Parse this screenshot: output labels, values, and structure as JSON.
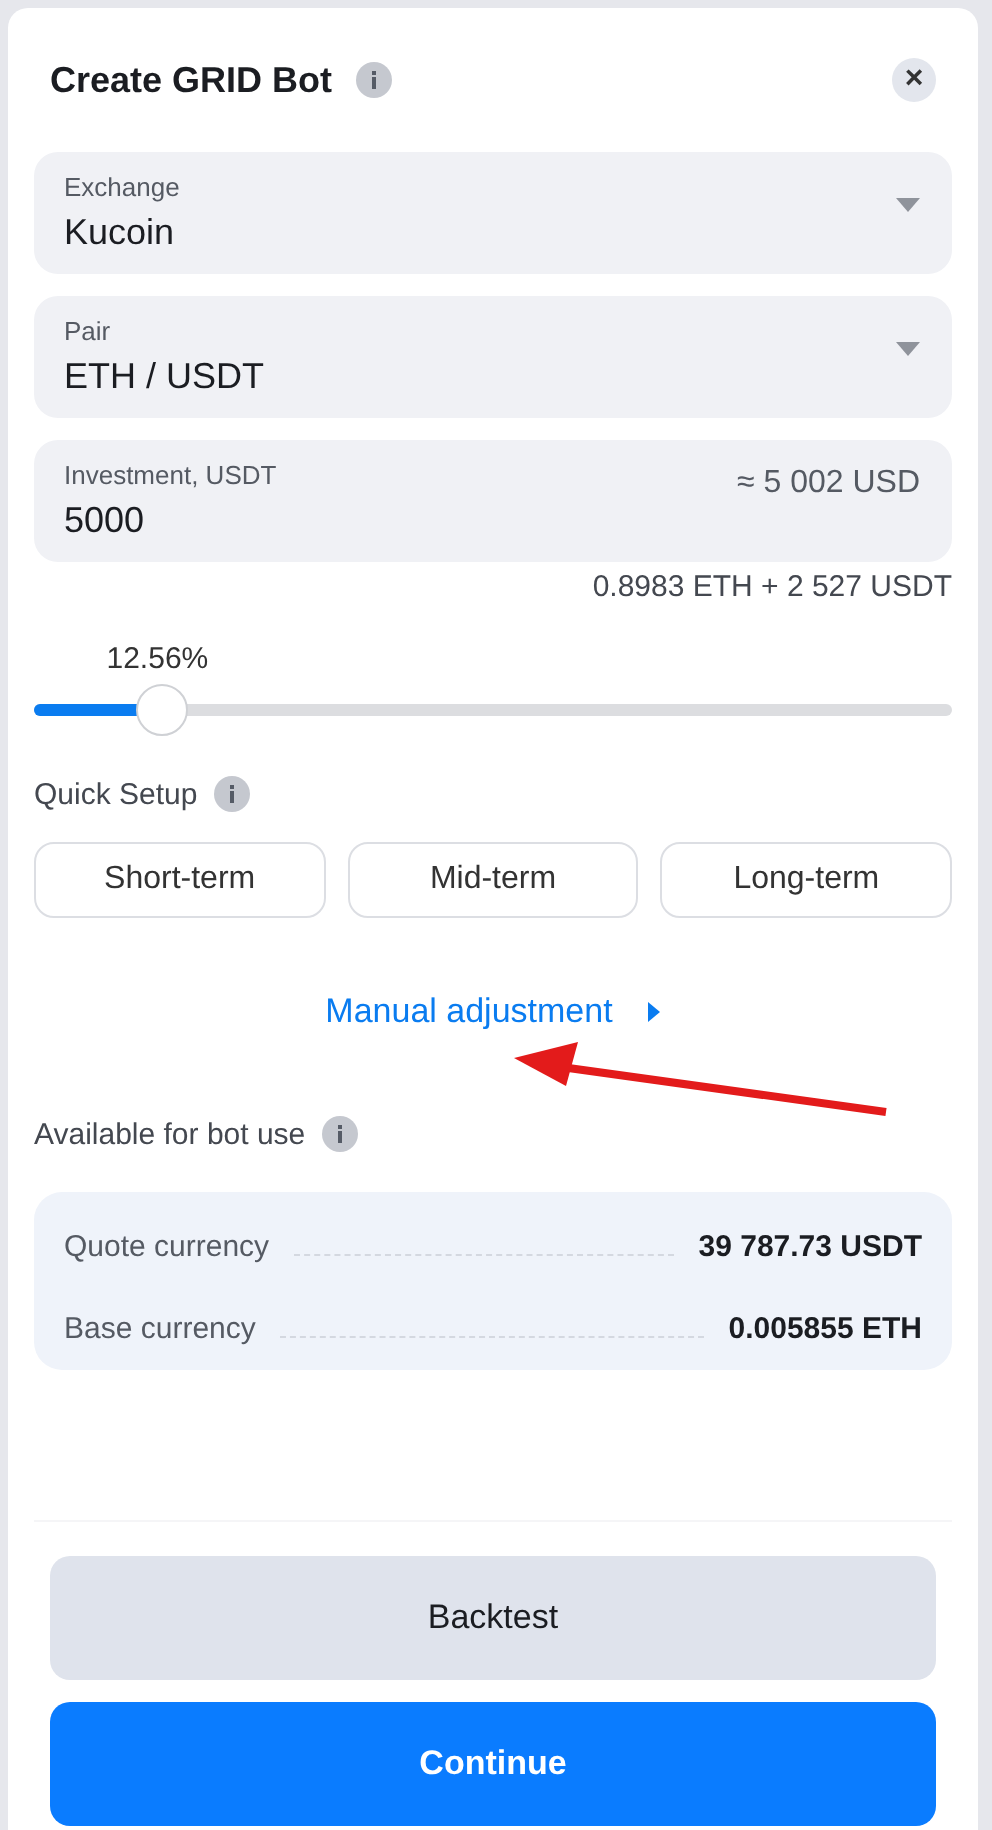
{
  "title": "Create GRID Bot",
  "close": "×",
  "fields": [
    {
      "label": "Exchange",
      "value": "Kucoin",
      "kind": "select"
    },
    {
      "label": "Pair",
      "value": "ETH / USDT",
      "kind": "select"
    },
    {
      "label": "Investment, USDT",
      "value": "5000",
      "kind": "input",
      "suffix": "≈ 5 002 USD"
    }
  ],
  "conversion": "0.8983 ETH + 2 527 USDT",
  "slider": {
    "reading": "12.56%",
    "level": 0.14
  },
  "quick_setup": {
    "label": "Quick Setup",
    "options": [
      {
        "label": "Short-term",
        "selected": false
      },
      {
        "label": "Mid-term",
        "selected": false
      },
      {
        "label": "Long-term",
        "selected": false
      }
    ]
  },
  "manual_link": "Manual adjustment",
  "available": {
    "label": "Available for bot use",
    "rows": [
      {
        "label": "Quote currency",
        "value": "39 787.73 USDT"
      },
      {
        "label": "Base currency",
        "value": "0.005855 ETH"
      }
    ]
  },
  "buttons": [
    {
      "label": "Backtest",
      "kind": "secondary"
    },
    {
      "label": "Continue",
      "kind": "primary"
    }
  ]
}
